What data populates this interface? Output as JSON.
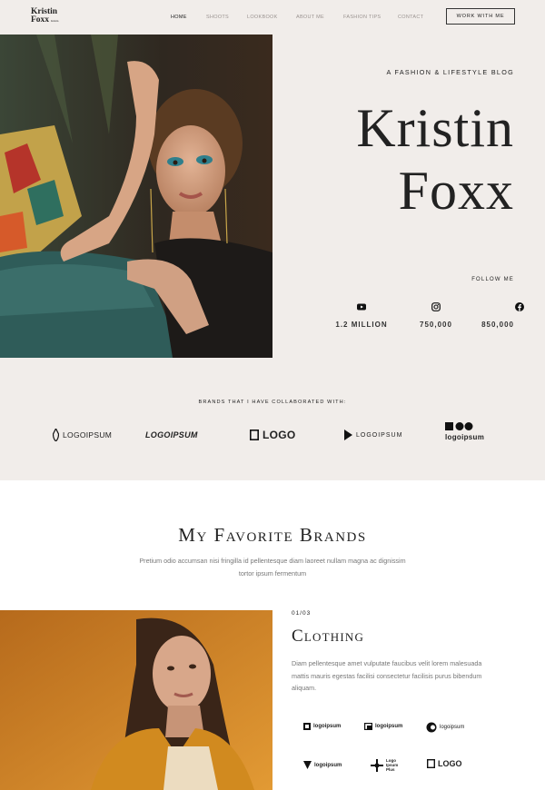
{
  "header": {
    "logo_line1": "Kristin",
    "logo_line2": "Foxx",
    "logo_tm": "Kristin",
    "nav": [
      "HOME",
      "SHOOTS",
      "LOOKBOOK",
      "ABOUT ME",
      "FASHION TIPS",
      "CONTACT"
    ],
    "cta": "WORK WITH ME"
  },
  "hero": {
    "tagline": "A FASHION & LIFESTYLE BLOG",
    "name_first": "Kristin",
    "name_last": "Foxx",
    "follow_label": "FOLLOW ME",
    "social": [
      {
        "icon": "youtube-icon",
        "count": "1.2 MILLION"
      },
      {
        "icon": "instagram-icon",
        "count": "750,000"
      },
      {
        "icon": "facebook-icon",
        "count": "850,000"
      }
    ]
  },
  "collab": {
    "title": "BRANDS THAT I HAVE COLLABORATED WITH:",
    "brands": [
      "LOGOIPSUM",
      "LOGOIPSUM",
      "LOGO",
      "LOGOIPSUM",
      "logoipsum"
    ]
  },
  "favorites": {
    "title": "My Favorite Brands",
    "description": "Pretium odio accumsan nisi fringilla id pellentesque diam laoreet nullam magna ac dignissim tortor ipsum fermentum",
    "counter": "01/03",
    "category": "Clothing",
    "category_desc": "Diam pellentesque amet vulputate faucibus velit lorem malesuada mattis mauris egestas facilisi consectetur facilisis purus bibendum aliquam.",
    "mini_brands": [
      "logoipsum",
      "logoipsum",
      "logoipsum",
      "logoipsum",
      "Logo Ipsum Plus",
      "LOGO"
    ]
  },
  "colors": {
    "bg": "#f1edea",
    "text": "#222222",
    "muted": "#777777"
  }
}
